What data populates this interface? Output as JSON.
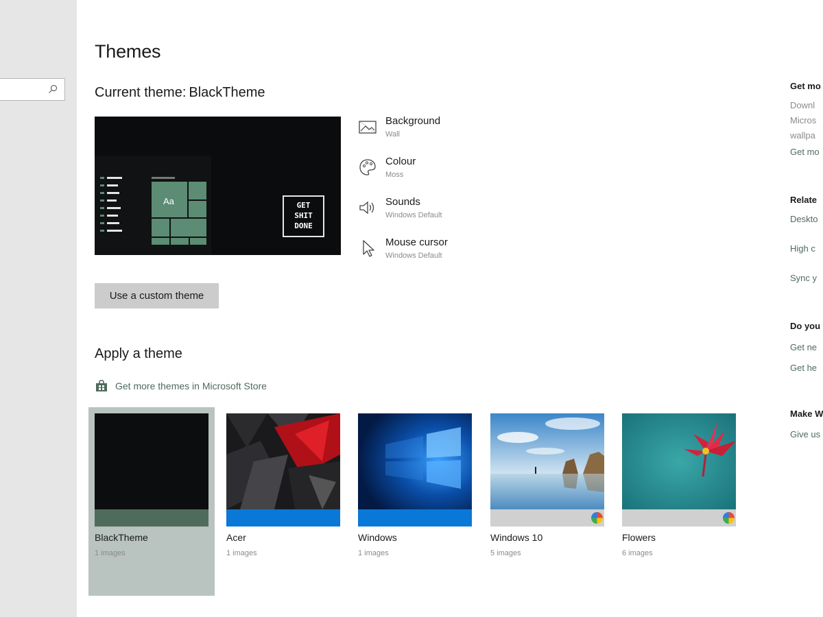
{
  "search": {
    "placeholder": ""
  },
  "page": {
    "title": "Themes"
  },
  "current_theme": {
    "label": "Current theme:",
    "name": "BlackTheme"
  },
  "preview": {
    "sample_text": "Aa",
    "wallpaper_lines": [
      "GET",
      "SHIT",
      "DONE"
    ]
  },
  "attributes": [
    {
      "label": "Background",
      "value": "Wall",
      "icon": "picture-icon"
    },
    {
      "label": "Colour",
      "value": "Moss",
      "icon": "palette-icon"
    },
    {
      "label": "Sounds",
      "value": "Windows Default",
      "icon": "speaker-icon"
    },
    {
      "label": "Mouse cursor",
      "value": "Windows Default",
      "icon": "cursor-icon"
    }
  ],
  "custom_theme_button": "Use a custom theme",
  "apply": {
    "title": "Apply a theme",
    "store_link": "Get more themes in Microsoft Store"
  },
  "themes": [
    {
      "name": "BlackTheme",
      "count": "1 images",
      "selected": true,
      "bar_color": "#4f6b5c"
    },
    {
      "name": "Acer",
      "count": "1 images",
      "selected": false,
      "bar_color": "#0a78d7"
    },
    {
      "name": "Windows",
      "count": "1 images",
      "selected": false,
      "bar_color": "#0a78d7"
    },
    {
      "name": "Windows 10",
      "count": "5 images",
      "selected": false,
      "bar_color": "#d0d0d0"
    },
    {
      "name": "Flowers",
      "count": "6 images",
      "selected": false,
      "bar_color": "#d0d0d0"
    }
  ],
  "rail": {
    "get_more_head": "Get mo",
    "get_more_lines": [
      "Downl",
      "Micros",
      "wallpa"
    ],
    "get_more_link": "Get mo",
    "related_head": "Relate",
    "related_links": [
      "Deskto",
      "High c",
      "Sync y"
    ],
    "question_head": "Do you",
    "question_links": [
      "Get ne",
      "Get he"
    ],
    "make_head": "Make W",
    "make_link": "Give us"
  },
  "colors": {
    "accent": "#4f6b5c",
    "windows_blue": "#0a78d7",
    "nav_bg": "#e6e6e6"
  }
}
